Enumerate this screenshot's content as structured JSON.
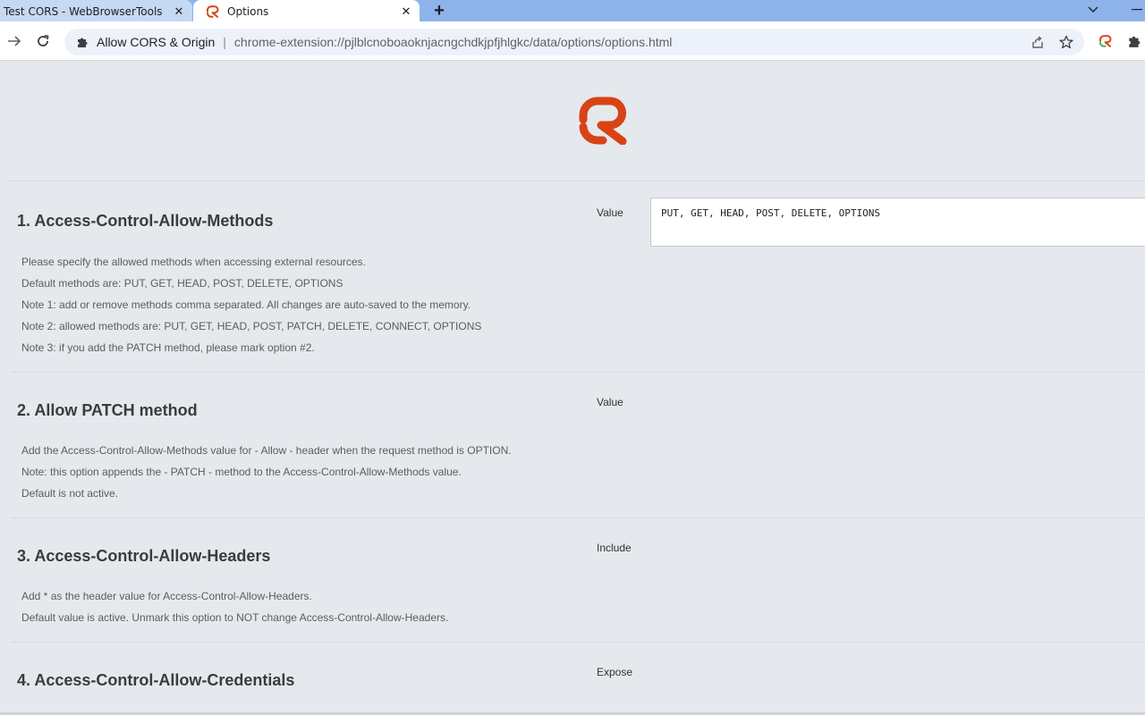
{
  "browser": {
    "tabs": [
      {
        "title": "Test CORS - WebBrowserTools",
        "active": false
      },
      {
        "title": "Options",
        "active": true
      }
    ],
    "new_tab_label": "+",
    "address": {
      "origin_label": "Allow CORS & Origin",
      "separator": "|",
      "url": "chrome-extension://pjlblcnoboaoknjacngchdkjpfjhlgkc/data/options/options.html"
    }
  },
  "colors": {
    "brand": "#d84315",
    "tab_strip": "#8db3ea",
    "page_background": "#e5e9ed"
  },
  "icons": {
    "back": "arrow-right-icon",
    "reload": "reload-icon",
    "extension": "puzzle-icon",
    "share": "share-icon",
    "bookmark": "star-icon",
    "brand": "allow-cors-logo"
  },
  "sections": [
    {
      "title": "1. Access-Control-Allow-Methods",
      "lines": [
        "Please specify the allowed methods when accessing external resources.",
        "Default methods are: PUT, GET, HEAD, POST, DELETE, OPTIONS",
        "Note 1: add or remove methods comma separated. All changes are auto-saved to the memory.",
        "Note 2: allowed methods are: PUT, GET, HEAD, POST, PATCH, DELETE, CONNECT, OPTIONS",
        "Note 3: if you add the PATCH method, please mark option #2."
      ],
      "control_label": "Value",
      "input_value": "PUT, GET, HEAD, POST, DELETE, OPTIONS"
    },
    {
      "title": "2. Allow PATCH method",
      "lines": [
        "Add the Access-Control-Allow-Methods value for - Allow - header when the request method is OPTION.",
        "Note: this option appends the - PATCH - method to the Access-Control-Allow-Methods value.",
        "Default is not active."
      ],
      "control_label": "Value"
    },
    {
      "title": "3. Access-Control-Allow-Headers",
      "lines": [
        "Add * as the header value for Access-Control-Allow-Headers.",
        "Default value is active. Unmark this option to NOT change Access-Control-Allow-Headers."
      ],
      "control_label": "Include"
    },
    {
      "title": "4. Access-Control-Allow-Credentials",
      "lines": [],
      "control_label": "Expose"
    }
  ]
}
